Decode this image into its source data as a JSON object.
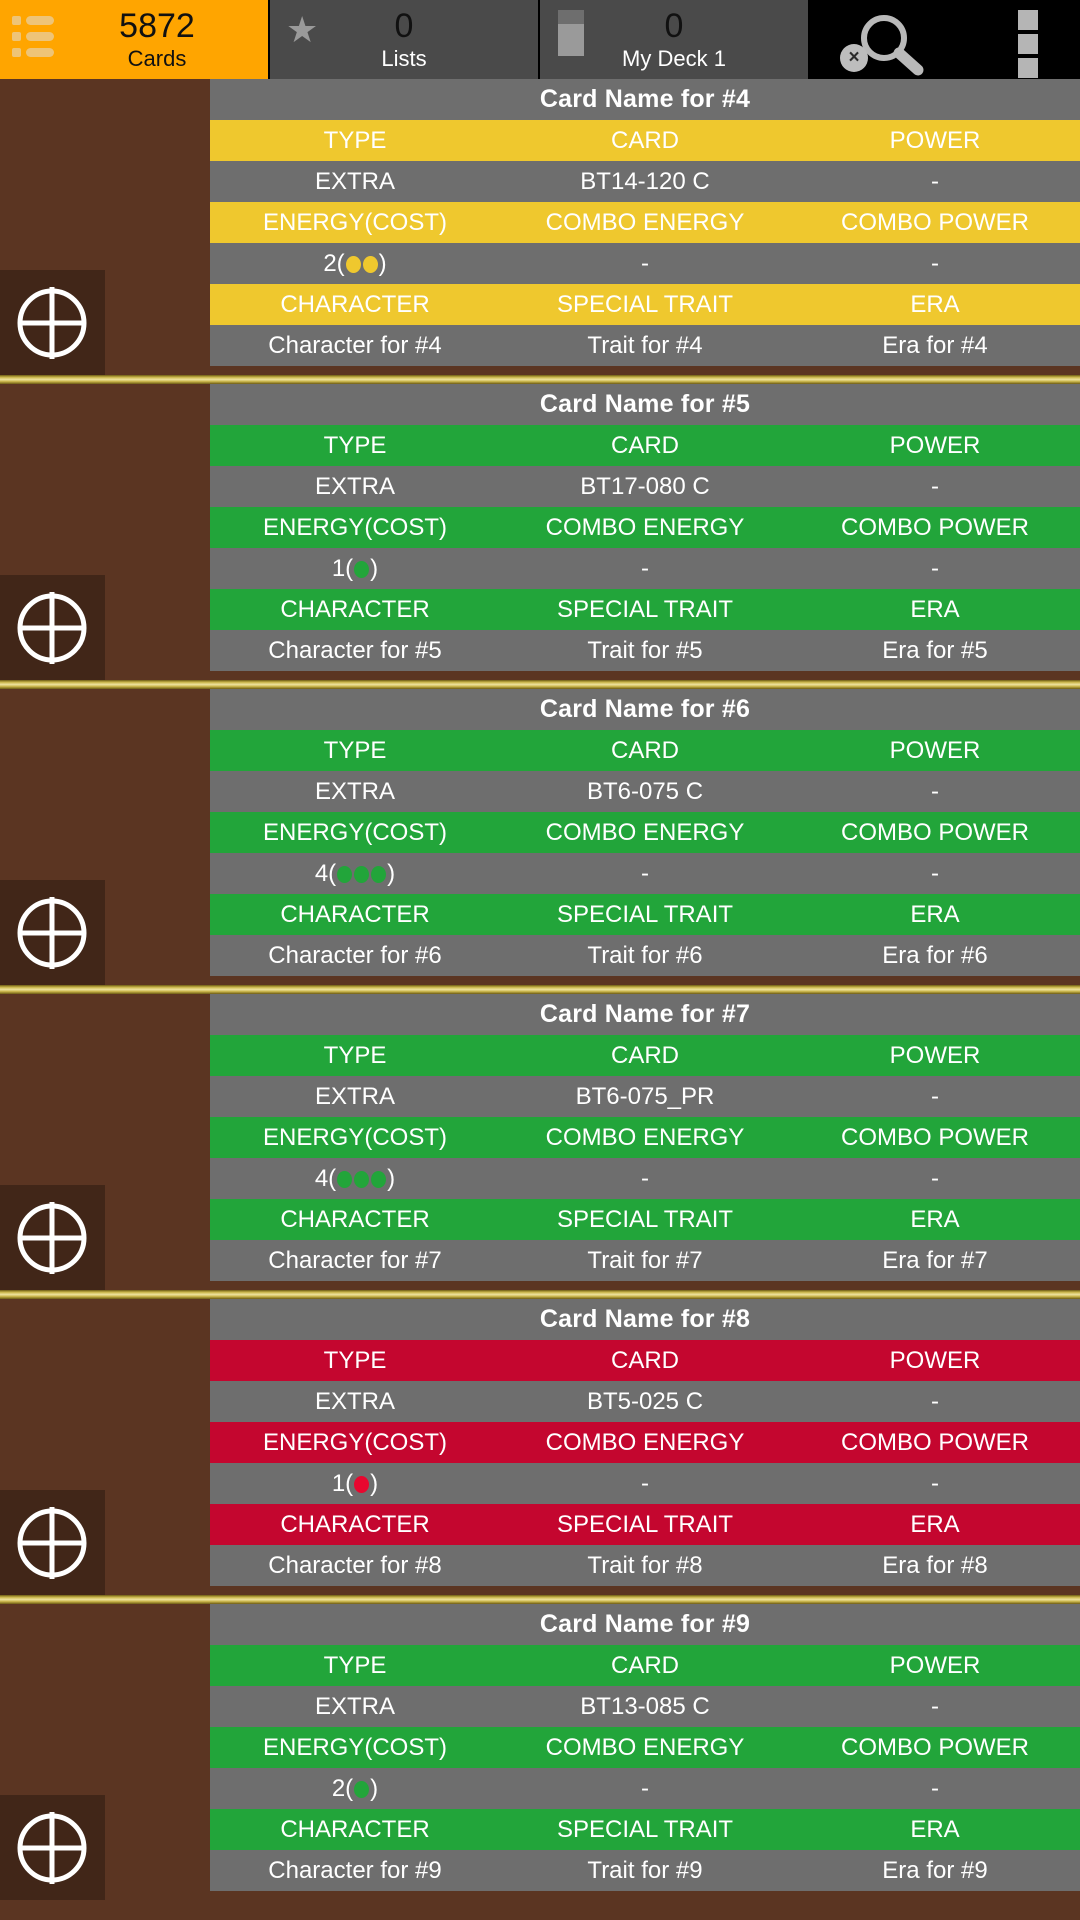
{
  "header": {
    "tabs": [
      {
        "name": "cards",
        "icon": "list-icon",
        "count": "5872",
        "label": "Cards",
        "active": true
      },
      {
        "name": "lists",
        "icon": "star-icon",
        "count": "0",
        "label": "Lists",
        "active": false
      },
      {
        "name": "deck",
        "icon": "deck-icon",
        "count": "0",
        "label": "My Deck 1",
        "active": false
      }
    ],
    "actions": {
      "search_icon": "search-icon",
      "search_clear_icon": "clear-search-icon",
      "search_clear_glyph": "×",
      "overflow_icon": "overflow-menu-icon"
    },
    "colors": {
      "active_tab": "#FFA500",
      "inactive_tab": "#4a4a4a",
      "action_bg": "#000000"
    }
  },
  "column_headers": {
    "row1": [
      "TYPE",
      "CARD",
      "POWER"
    ],
    "row2": [
      "ENERGY(COST)",
      "COMBO ENERGY",
      "COMBO POWER"
    ],
    "row3": [
      "CHARACTER",
      "SPECIAL TRAIT",
      "ERA"
    ]
  },
  "colors": {
    "yellow": "#EFC82E",
    "green": "#22A53A",
    "crimson": "#C4062F",
    "row_bg": "#6e6e6e",
    "thumb_bg": "#5b3522"
  },
  "cards": [
    {
      "title": "Card Name for #4",
      "accent": "#EFC82E",
      "type": "EXTRA",
      "card": "BT14-120 C",
      "power": "-",
      "energy_cost": "2",
      "energy_dots": 2,
      "dot_color": "#EFC82E",
      "combo_energy": "-",
      "combo_power": "-",
      "character": "Character for #4",
      "trait": "Trait for #4",
      "era": "Era for #4"
    },
    {
      "title": "Card Name for #5",
      "accent": "#22A53A",
      "type": "EXTRA",
      "card": "BT17-080 C",
      "power": "-",
      "energy_cost": "1",
      "energy_dots": 1,
      "dot_color": "#22A53A",
      "combo_energy": "-",
      "combo_power": "-",
      "character": "Character for #5",
      "trait": "Trait for #5",
      "era": "Era for #5"
    },
    {
      "title": "Card Name for #6",
      "accent": "#22A53A",
      "type": "EXTRA",
      "card": "BT6-075 C",
      "power": "-",
      "energy_cost": "4",
      "energy_dots": 3,
      "dot_color": "#22A53A",
      "combo_energy": "-",
      "combo_power": "-",
      "character": "Character for #6",
      "trait": "Trait for #6",
      "era": "Era for #6"
    },
    {
      "title": "Card Name for #7",
      "accent": "#22A53A",
      "type": "EXTRA",
      "card": "BT6-075_PR",
      "power": "-",
      "energy_cost": "4",
      "energy_dots": 3,
      "dot_color": "#22A53A",
      "combo_energy": "-",
      "combo_power": "-",
      "character": "Character for #7",
      "trait": "Trait for #7",
      "era": "Era for #7"
    },
    {
      "title": "Card Name for #8",
      "accent": "#C4062F",
      "type": "EXTRA",
      "card": "BT5-025 C",
      "power": "-",
      "energy_cost": "1",
      "energy_dots": 1,
      "dot_color": "#E8072F",
      "combo_energy": "-",
      "combo_power": "-",
      "character": "Character for #8",
      "trait": "Trait for #8",
      "era": "Era for #8"
    },
    {
      "title": "Card Name for #9",
      "accent": "#22A53A",
      "type": "EXTRA",
      "card": "BT13-085 C",
      "power": "-",
      "energy_cost": "2",
      "energy_dots": 1,
      "dot_color": "#22A53A",
      "combo_energy": "-",
      "combo_power": "-",
      "character": "Character for #9",
      "trait": "Trait for #9",
      "era": "Era for #9"
    }
  ]
}
